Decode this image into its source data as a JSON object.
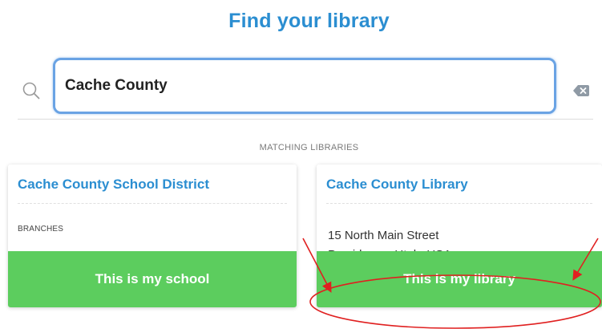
{
  "header": {
    "title": "Find your library"
  },
  "search": {
    "value": "Cache County",
    "icon": "search-icon",
    "clear_icon": "backspace-clear-icon"
  },
  "results": {
    "section_label": "MATCHING LIBRARIES",
    "cards": [
      {
        "title": "Cache County School District",
        "subtitle": "BRANCHES",
        "button_label": "This is my school"
      },
      {
        "title": "Cache County Library",
        "address_line1": "15 North Main Street",
        "address_line2": "Providence, Utah, USA",
        "button_label": "This is my library"
      }
    ]
  },
  "annotation": {
    "color": "#e02020"
  },
  "colors": {
    "accent_blue": "#2b8ed1",
    "button_green": "#5ccd5e",
    "input_border": "#6aa3e4"
  }
}
